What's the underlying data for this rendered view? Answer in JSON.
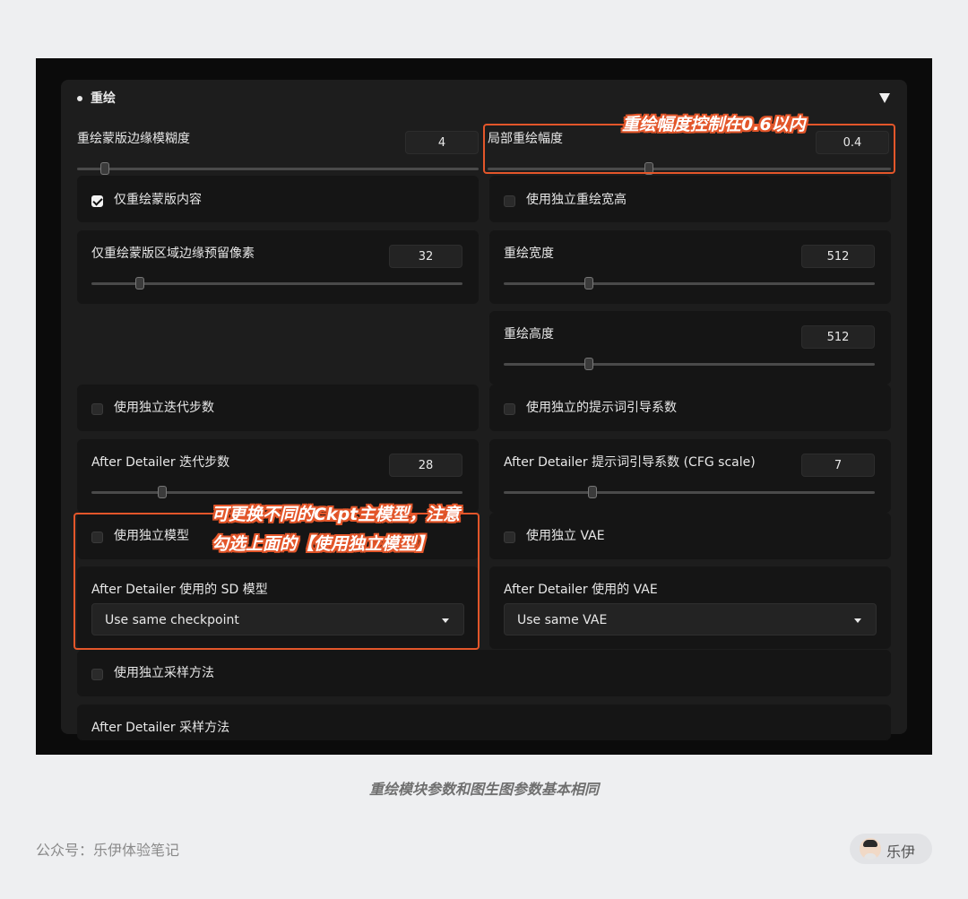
{
  "section": {
    "title": "重绘",
    "collapse_icon": "triangle-down-icon"
  },
  "fields": {
    "mask_blur": {
      "label": "重绘蒙版边缘模糊度",
      "value": "4",
      "slider": 0.07
    },
    "local_denoise": {
      "label": "局部重绘幅度",
      "value": "0.4",
      "slider": 0.4
    },
    "inpaint_only_masked": {
      "label": "仅重绘蒙版内容",
      "checked": true
    },
    "use_separate_size": {
      "label": "使用独立重绘宽高",
      "checked": false
    },
    "inpaint_padding": {
      "label": "仅重绘蒙版区域边缘预留像素",
      "value": "32",
      "slider": 0.13
    },
    "inpaint_width": {
      "label": "重绘宽度",
      "value": "512",
      "slider": 0.23
    },
    "inpaint_height": {
      "label": "重绘高度",
      "value": "512",
      "slider": 0.23
    },
    "use_separate_steps": {
      "label": "使用独立迭代步数",
      "checked": false
    },
    "use_separate_cfg": {
      "label": "使用独立的提示词引导系数",
      "checked": false
    },
    "steps": {
      "label": "After Detailer 迭代步数",
      "value": "28",
      "slider": 0.19
    },
    "cfg_scale": {
      "label": "After Detailer 提示词引导系数 (CFG scale)",
      "value": "7",
      "slider": 0.24
    },
    "use_separate_model": {
      "label": "使用独立模型",
      "checked": false
    },
    "use_separate_vae": {
      "label": "使用独立 VAE",
      "checked": false
    },
    "sd_model": {
      "label": "After Detailer 使用的 SD 模型",
      "value": "Use same checkpoint"
    },
    "vae": {
      "label": "After Detailer 使用的 VAE",
      "value": "Use same VAE"
    },
    "use_separate_sampler": {
      "label": "使用独立采样方法",
      "checked": false
    },
    "sampler": {
      "label": "After Detailer 采样方法"
    }
  },
  "annotations": {
    "denoise_note": "重绘幅度控制在0.6以内",
    "model_note_line1": "可更换不同的Ckpt主模型，注意",
    "model_note_line2": "勾选上面的【使用独立模型】",
    "highlight_color": "#e3562a"
  },
  "caption": "重绘模块参数和图生图参数基本相同",
  "footer": {
    "account": "公众号：乐伊体验笔记",
    "author_name": "乐伊",
    "avatar_icon": "person-avatar-icon"
  }
}
